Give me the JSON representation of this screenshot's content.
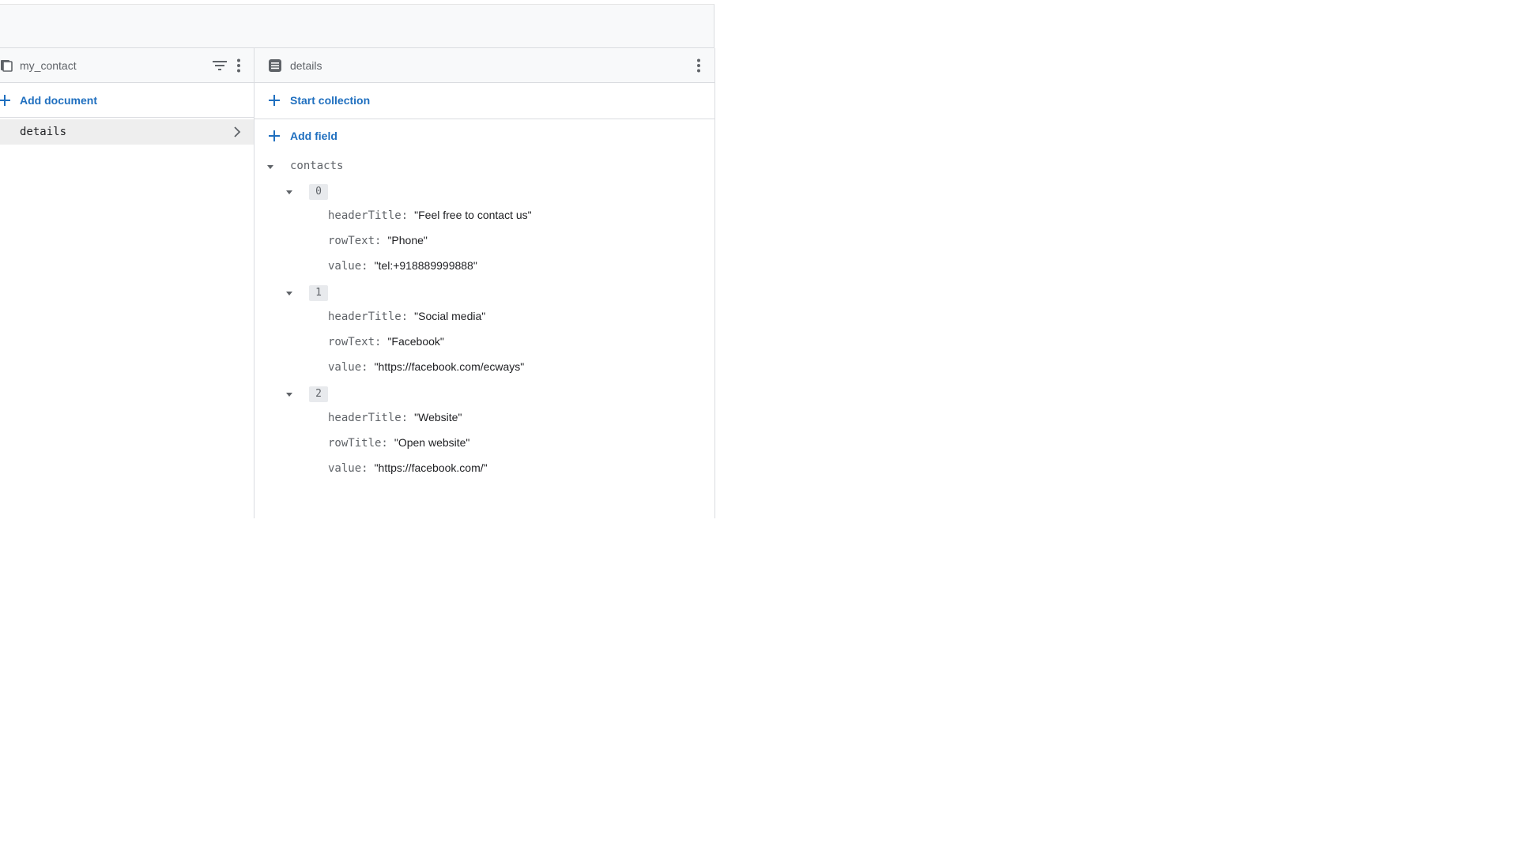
{
  "left_panel": {
    "collection_name": "my_contact",
    "add_document_label": "Add document",
    "documents": [
      {
        "label": "details"
      }
    ]
  },
  "right_panel": {
    "document_name": "details",
    "start_collection_label": "Start collection",
    "add_field_label": "Add field",
    "fields": {
      "name": "contacts",
      "items": [
        {
          "index": "0",
          "entries": [
            {
              "key": "headerTitle:",
              "value": "\"Feel free to contact us\""
            },
            {
              "key": "rowText:",
              "value": "\"Phone\""
            },
            {
              "key": "value:",
              "value": "\"tel:+918889999888\""
            }
          ]
        },
        {
          "index": "1",
          "entries": [
            {
              "key": "headerTitle:",
              "value": "\"Social media\""
            },
            {
              "key": "rowText:",
              "value": "\"Facebook\""
            },
            {
              "key": "value:",
              "value": "\"https://facebook.com/ecways\""
            }
          ]
        },
        {
          "index": "2",
          "entries": [
            {
              "key": "headerTitle:",
              "value": "\"Website\""
            },
            {
              "key": "rowTitle:",
              "value": "\"Open website\""
            },
            {
              "key": "value:",
              "value": "\"https://facebook.com/\""
            }
          ]
        }
      ]
    }
  },
  "icons": {
    "collection": "collection-icon",
    "filter": "filter-icon",
    "more": "more-vert-icon",
    "document": "document-icon",
    "add": "plus-icon",
    "chevron": "chevron-right-icon",
    "caret": "caret-down-icon"
  },
  "colors": {
    "accent": "#1f6fbf",
    "selected_row": "#eeeeee",
    "header_bg": "#f8f9fa",
    "border": "#dadce0"
  }
}
